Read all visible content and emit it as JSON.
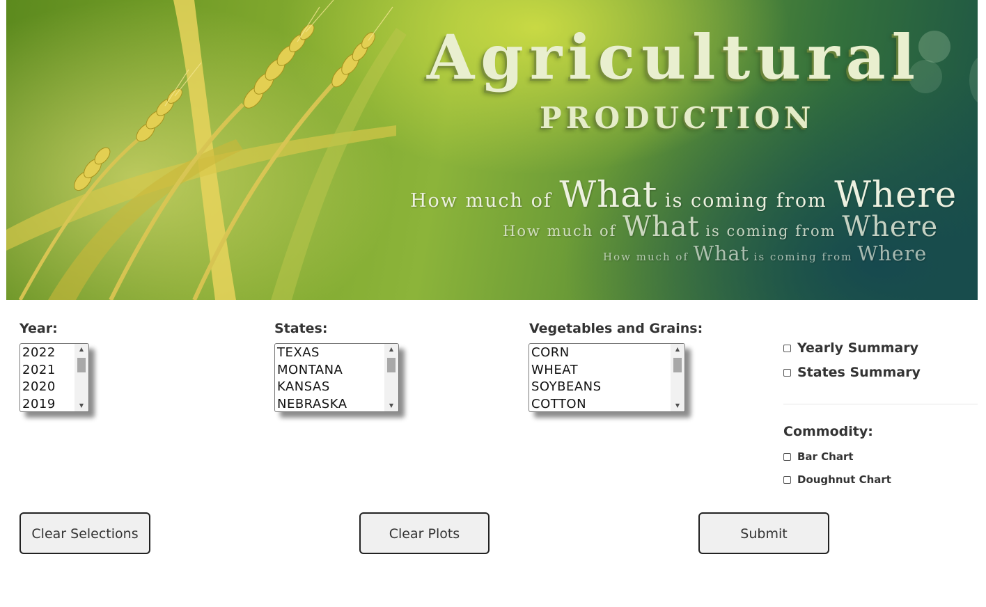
{
  "banner": {
    "title": "Agricultural",
    "subtitle": "PRODUCTION",
    "tagline": {
      "part1": "How much of",
      "word_what": "What",
      "part2": "is coming from",
      "word_where": "Where"
    }
  },
  "form": {
    "year": {
      "label": "Year:",
      "options": [
        "2022",
        "2021",
        "2020",
        "2019"
      ]
    },
    "states": {
      "label": "States:",
      "options": [
        "TEXAS",
        "MONTANA",
        "KANSAS",
        "NEBRASKA"
      ]
    },
    "commodities": {
      "label": "Vegetables and Grains:",
      "options": [
        "CORN",
        "WHEAT",
        "SOYBEANS",
        "COTTON"
      ]
    },
    "summary": {
      "yearly": "Yearly Summary",
      "states": "States Summary"
    },
    "commodity_charts": {
      "label": "Commodity:",
      "bar": "Bar Chart",
      "doughnut": "Doughnut Chart"
    }
  },
  "buttons": {
    "clear_selections": "Clear Selections",
    "clear_plots": "Clear Plots",
    "submit": "Submit"
  },
  "icons": {
    "scroll_up": "scroll-up-arrow-icon",
    "scroll_down": "scroll-down-arrow-icon"
  }
}
